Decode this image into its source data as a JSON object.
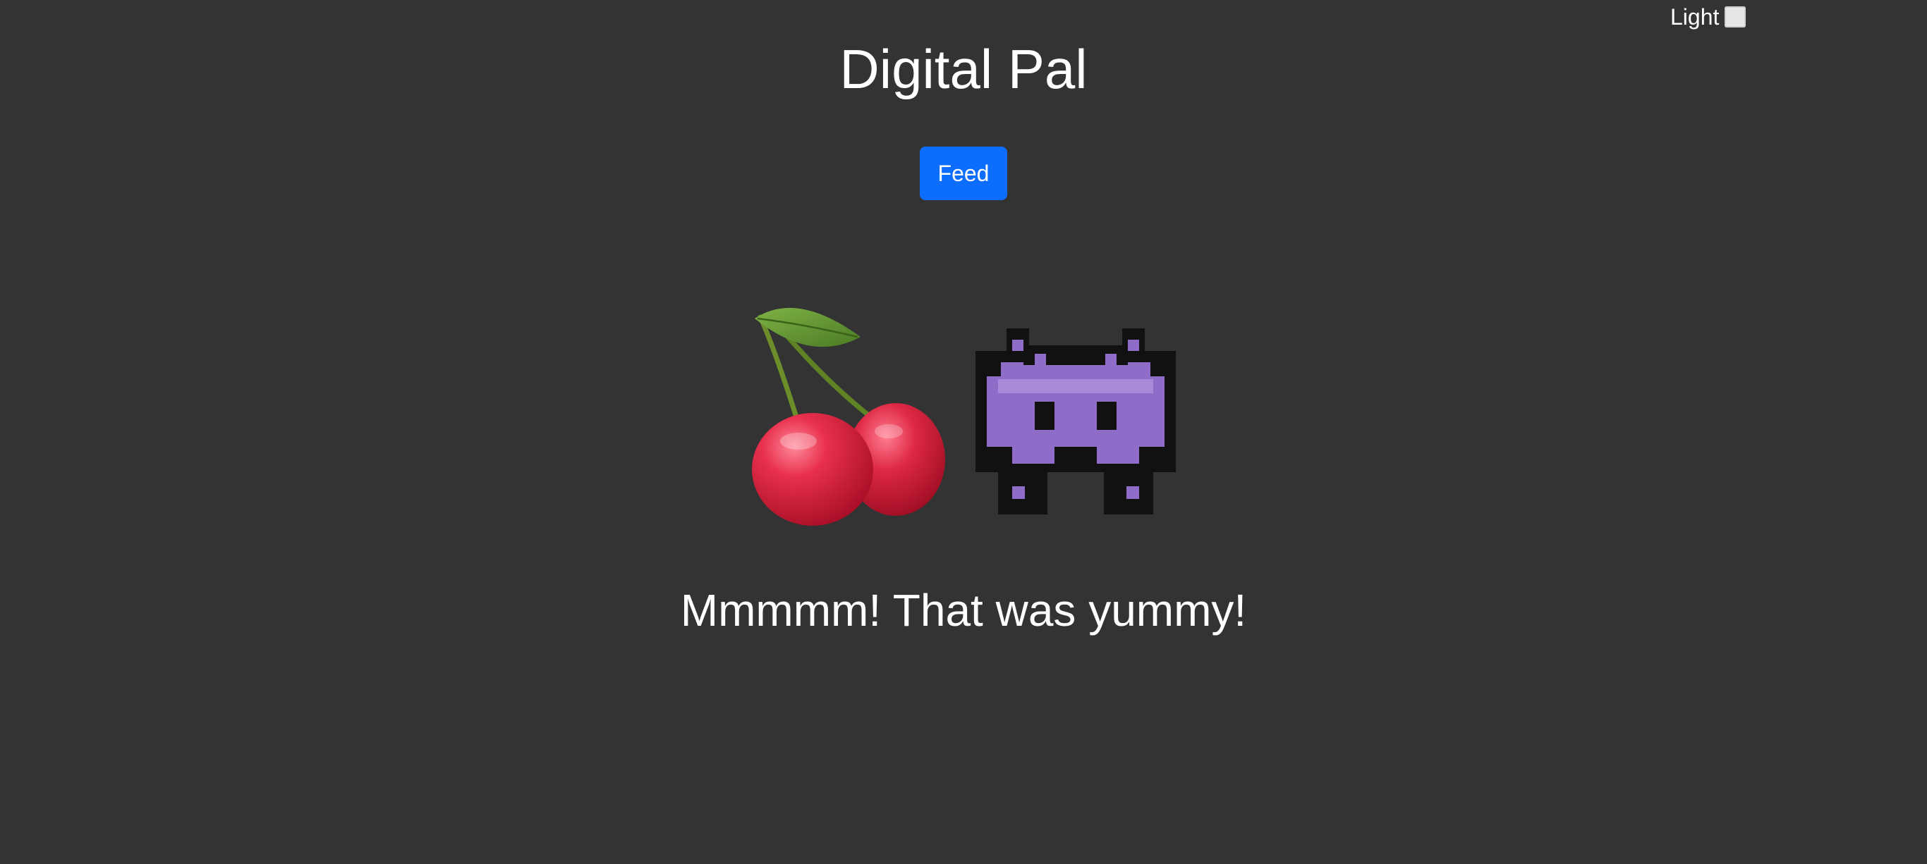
{
  "theme_toggle": {
    "label": "Light",
    "icon": "white-square-icon"
  },
  "title": "Digital Pal",
  "feed_button": {
    "label": "Feed"
  },
  "scene": {
    "food_icon": "cherries-icon",
    "pet_icon": "alien-monster-icon"
  },
  "message": "Mmmmm! That was yummy!",
  "colors": {
    "background": "#333333",
    "text": "#ffffff",
    "button": "#0d6efd",
    "monster": "#8e6cc7",
    "cherry": "#d81f3a",
    "leaf": "#5c8f2e"
  }
}
